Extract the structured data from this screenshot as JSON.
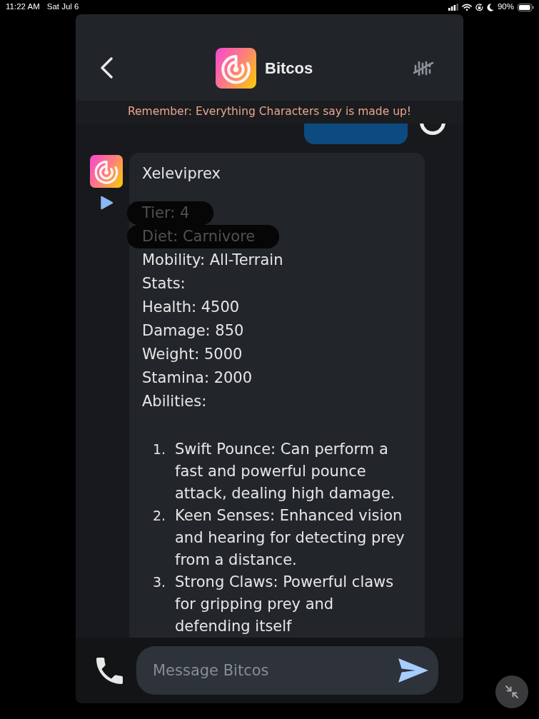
{
  "status_bar": {
    "time": "11:22 AM",
    "date": "Sat Jul 6",
    "battery": "90%"
  },
  "header": {
    "title": "Bitcos"
  },
  "banner": {
    "text": "Remember: Everything Characters say is made up!"
  },
  "messages": [
    {
      "kind": "user"
    },
    {
      "kind": "bot",
      "title": "Xeleviprex",
      "lines": [
        {
          "text": "Tier: 4",
          "redacted": true
        },
        {
          "text": "Diet: Carnivore",
          "redacted": true
        },
        {
          "text": "Mobility: All-Terrain",
          "redacted": false
        },
        {
          "text": "Stats:",
          "redacted": false
        },
        {
          "text": "Health: 4500",
          "redacted": false
        },
        {
          "text": "Damage: 850",
          "redacted": false
        },
        {
          "text": "Weight: 5000",
          "redacted": false
        },
        {
          "text": "Stamina: 2000",
          "redacted": false
        },
        {
          "text": "Abilities:",
          "redacted": false
        }
      ],
      "abilities": [
        {
          "number": "1.",
          "text": "Swift Pounce: Can perform a fast and powerful pounce attack, dealing high damage."
        },
        {
          "number": "2.",
          "text": "Keen Senses: Enhanced vision and hearing for detecting prey from a distance."
        },
        {
          "number": "3.",
          "text": "Strong Claws: Powerful claws for gripping prey and defending itself"
        }
      ]
    }
  ],
  "composer": {
    "placeholder": "Message Bitcos"
  }
}
